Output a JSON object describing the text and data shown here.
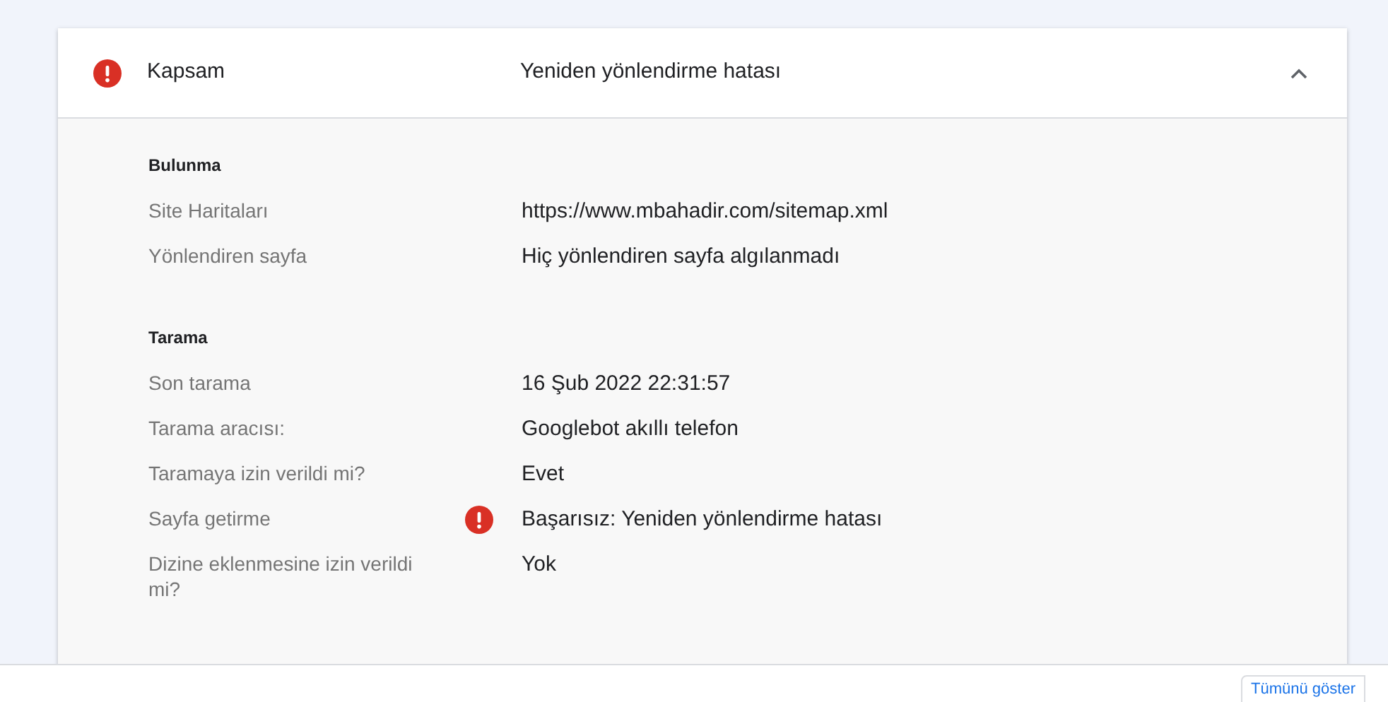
{
  "panel": {
    "error": true,
    "title": "Kapsam",
    "value": "Yeniden yönlendirme hatası",
    "expanded": true,
    "sections": [
      {
        "heading": "Bulunma",
        "rows": [
          {
            "label": "Site Haritaları",
            "value": "https://www.mbahadir.com/sitemap.xml",
            "error": false
          },
          {
            "label": "Yönlendiren sayfa",
            "value": "Hiç yönlendiren sayfa algılanmadı",
            "error": false
          }
        ]
      },
      {
        "heading": "Tarama",
        "rows": [
          {
            "label": "Son tarama",
            "value": "16 Şub 2022 22:31:57",
            "error": false
          },
          {
            "label": "Tarama aracısı:",
            "value": "Googlebot akıllı telefon",
            "error": false
          },
          {
            "label": "Taramaya izin verildi mi?",
            "value": "Evet",
            "error": false
          },
          {
            "label": "Sayfa getirme",
            "value": "Başarısız: Yeniden yönlendirme hatası",
            "error": true
          },
          {
            "label": "Dizine eklenmesine izin verildi mi?",
            "value": "Yok",
            "error": false
          }
        ]
      }
    ]
  },
  "footer": {
    "button": "Tümünü göster"
  }
}
